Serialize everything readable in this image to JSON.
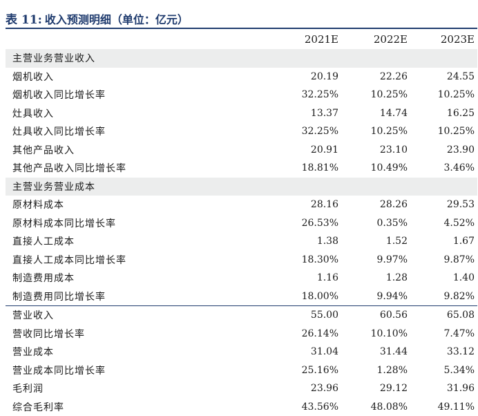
{
  "title": {
    "label": "表 11:",
    "text": "收入预测明细（单位：亿元）"
  },
  "columns": [
    "",
    "2021E",
    "2022E",
    "2023E"
  ],
  "rows": [
    {
      "kind": "section",
      "name": "主营业务营业收入"
    },
    {
      "kind": "data",
      "name": "烟机收入",
      "values": [
        "20.19",
        "22.26",
        "24.55"
      ]
    },
    {
      "kind": "data",
      "name": "烟机收入同比增长率",
      "values": [
        "32.25%",
        "10.25%",
        "10.25%"
      ]
    },
    {
      "kind": "data",
      "name": "灶具收入",
      "values": [
        "13.37",
        "14.74",
        "16.25"
      ]
    },
    {
      "kind": "data",
      "name": "灶具收入同比增长率",
      "values": [
        "32.25%",
        "10.25%",
        "10.25%"
      ]
    },
    {
      "kind": "data",
      "name": "其他产品收入",
      "values": [
        "20.91",
        "23.10",
        "23.90"
      ]
    },
    {
      "kind": "data",
      "name": "其他产品收入同比增长率",
      "values": [
        "18.81%",
        "10.49%",
        "3.46%"
      ]
    },
    {
      "kind": "section",
      "name": "主营业务营业成本"
    },
    {
      "kind": "data",
      "name": "原材料成本",
      "values": [
        "28.16",
        "28.26",
        "29.53"
      ]
    },
    {
      "kind": "data",
      "name": "原材料成本同比增长率",
      "values": [
        "26.53%",
        "0.35%",
        "4.52%"
      ]
    },
    {
      "kind": "data",
      "name": "直接人工成本",
      "values": [
        "1.38",
        "1.52",
        "1.67"
      ]
    },
    {
      "kind": "data",
      "name": "直接人工成本同比增长率",
      "values": [
        "18.30%",
        "9.97%",
        "9.87%"
      ]
    },
    {
      "kind": "data",
      "name": "制造费用成本",
      "values": [
        "1.16",
        "1.28",
        "1.40"
      ]
    },
    {
      "kind": "data",
      "name": "制造费用同比增长率",
      "values": [
        "18.00%",
        "9.94%",
        "9.82%"
      ]
    },
    {
      "kind": "data",
      "sep": true,
      "name": "营业收入",
      "values": [
        "55.00",
        "60.56",
        "65.08"
      ]
    },
    {
      "kind": "data",
      "name": "营收同比增长率",
      "values": [
        "26.14%",
        "10.10%",
        "7.47%"
      ]
    },
    {
      "kind": "data",
      "name": "营业成本",
      "values": [
        "31.04",
        "31.44",
        "33.12"
      ]
    },
    {
      "kind": "data",
      "name": "营业成本同比增长率",
      "values": [
        "25.16%",
        "1.28%",
        "5.34%"
      ]
    },
    {
      "kind": "data",
      "name": "毛利润",
      "values": [
        "23.96",
        "29.12",
        "31.96"
      ]
    },
    {
      "kind": "data",
      "name": "综合毛利率",
      "values": [
        "43.56%",
        "48.08%",
        "49.11%"
      ]
    }
  ]
}
